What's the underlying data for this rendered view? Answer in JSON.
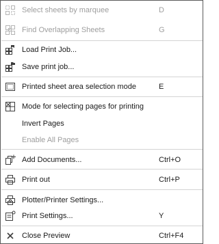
{
  "menu": {
    "items": [
      {
        "label": "Select sheets by marquee",
        "shortcut": "D",
        "icon": "marquee-select-icon",
        "disabled": true
      },
      {
        "label": "Find Overlapping Sheets",
        "shortcut": "G",
        "icon": "overlapping-sheets-icon",
        "disabled": true
      },
      {
        "label": "Load Print Job...",
        "shortcut": "",
        "icon": "load-print-job-icon",
        "disabled": false
      },
      {
        "label": "Save print job...",
        "shortcut": "",
        "icon": "save-print-job-icon",
        "disabled": false
      },
      {
        "label": "Printed sheet area selection mode",
        "shortcut": "E",
        "icon": "sheet-area-selection-icon",
        "disabled": false
      },
      {
        "label": "Mode for selecting pages for printing",
        "shortcut": "",
        "icon": "page-selection-mode-icon",
        "disabled": false
      },
      {
        "label": "Invert Pages",
        "shortcut": "",
        "icon": "",
        "disabled": false
      },
      {
        "label": "Enable All Pages",
        "shortcut": "",
        "icon": "",
        "disabled": true
      },
      {
        "label": "Add Documents...",
        "shortcut": "Ctrl+O",
        "icon": "add-documents-icon",
        "disabled": false
      },
      {
        "label": "Print out",
        "shortcut": "Ctrl+P",
        "icon": "printer-icon",
        "disabled": false
      },
      {
        "label": "Plotter/Printer Settings...",
        "shortcut": "",
        "icon": "plotter-settings-icon",
        "disabled": false
      },
      {
        "label": "Print Settings...",
        "shortcut": "Y",
        "icon": "print-settings-icon",
        "disabled": false
      },
      {
        "label": "Close Preview",
        "shortcut": "Ctrl+F4",
        "icon": "close-icon",
        "disabled": false
      }
    ]
  },
  "colors": {
    "text": "#1a1a1a",
    "disabled_text": "#9e9e9e",
    "separator": "#d4d4d4",
    "icon": "#3c3c3c",
    "border": "#5a5a5a"
  }
}
